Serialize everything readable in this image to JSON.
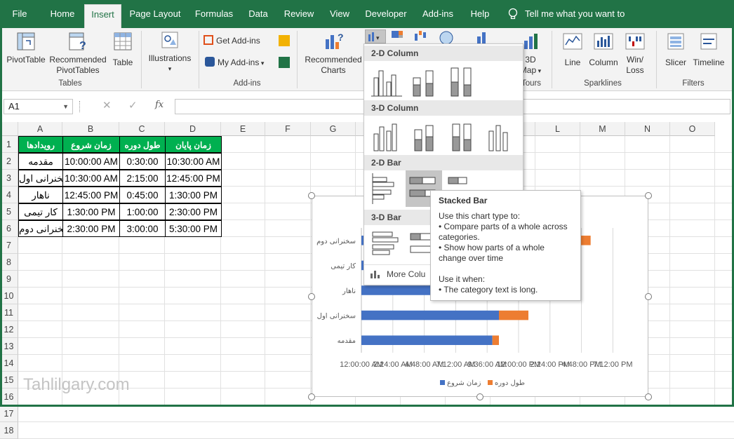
{
  "tabs": [
    "File",
    "Home",
    "Insert",
    "Page Layout",
    "Formulas",
    "Data",
    "Review",
    "View",
    "Developer",
    "Add-ins",
    "Help"
  ],
  "tell_me": "Tell me what you want to do",
  "ribbon": {
    "pivottable": "PivotTable",
    "rec_pivot_1": "Recommended",
    "rec_pivot_2": "PivotTables",
    "table": "Table",
    "tables_group": "Tables",
    "illustrations": "Illustrations",
    "get_addins": "Get Add-ins",
    "my_addins": "My Add-ins",
    "addins_group": "Add-ins",
    "rec_charts_1": "Recommended",
    "rec_charts_2": "Charts",
    "map_1": "3D",
    "map_2": "Map",
    "tours_group": "Tours",
    "line": "Line",
    "column": "Column",
    "winloss_1": "Win/",
    "winloss_2": "Loss",
    "sparklines_group": "Sparklines",
    "slicer": "Slicer",
    "timeline": "Timeline",
    "filters_group": "Filters"
  },
  "formula_bar": {
    "name_box": "A1",
    "fx": "fx",
    "formula": ""
  },
  "columns": [
    "A",
    "B",
    "C",
    "D",
    "E",
    "F",
    "G",
    "H",
    "I",
    "J",
    "K",
    "L",
    "M",
    "N",
    "O"
  ],
  "rows": [
    "1",
    "2",
    "3",
    "4",
    "5",
    "6",
    "7",
    "8",
    "9",
    "10",
    "11",
    "12",
    "13",
    "14",
    "15",
    "16",
    "17",
    "18"
  ],
  "table": {
    "headers": [
      "رویدادها",
      "زمان شروع",
      "طول دوره",
      "زمان پایان"
    ],
    "rows": [
      [
        "مقدمه",
        "10:00:00 AM",
        "0:30:00",
        "10:30:00 AM"
      ],
      [
        "سخنرانی اول",
        "10:30:00 AM",
        "2:15:00",
        "12:45:00 PM"
      ],
      [
        "ناهار",
        "12:45:00 PM",
        "0:45:00",
        "1:30:00 PM"
      ],
      [
        "کار تیمی",
        "1:30:00 PM",
        "1:00:00",
        "2:30:00 PM"
      ],
      [
        "سخنرانی دوم",
        "2:30:00 PM",
        "3:00:00",
        "5:30:00 PM"
      ]
    ]
  },
  "dropdown": {
    "sec_2d_col": "2-D Column",
    "sec_3d_col": "3-D Column",
    "sec_2d_bar": "2-D Bar",
    "sec_3d_bar": "3-D Bar",
    "more": "More Colu"
  },
  "tooltip": {
    "title": "Stacked Bar",
    "l1": "Use this chart type to:",
    "l2": "• Compare parts of a whole across",
    "l3": "categories.",
    "l4": "• Show how parts of a whole",
    "l5": "change over time",
    "l6": "Use it when:",
    "l7": "• The category text is long."
  },
  "watermark": "Tahlilgary.com",
  "colors": {
    "excel_green": "#217346",
    "header_green": "#00b050",
    "series_start": "#4472c4",
    "series_duration": "#ed7d31"
  },
  "chart_data": {
    "type": "bar",
    "stacked": true,
    "categories": [
      "مقدمه",
      "سخنرانی اول",
      "ناهار",
      "کار تیمی",
      "سخنرانی دوم"
    ],
    "series": [
      {
        "name": "زمان شروع",
        "values": [
          0.4167,
          0.4375,
          0.5313,
          0.5625,
          0.6042
        ]
      },
      {
        "name": "طول دوره",
        "values": [
          0.0208,
          0.0938,
          0.0313,
          0.0417,
          0.125
        ]
      }
    ],
    "xlim": [
      0,
      0.875
    ],
    "x_ticks": [
      "12:00:00 AM",
      "2:24:00 AM",
      "4:48:00 AM",
      "7:12:00 AM",
      "9:36:00 AM",
      "12:00:00 PM",
      "2:24:00 PM",
      "4:48:00 PM",
      "7:12:00 PM"
    ],
    "x_tick_values": [
      0,
      0.1,
      0.2,
      0.3,
      0.4,
      0.5,
      0.6,
      0.7,
      0.8
    ],
    "legend": "bottom",
    "gridlines": true
  }
}
